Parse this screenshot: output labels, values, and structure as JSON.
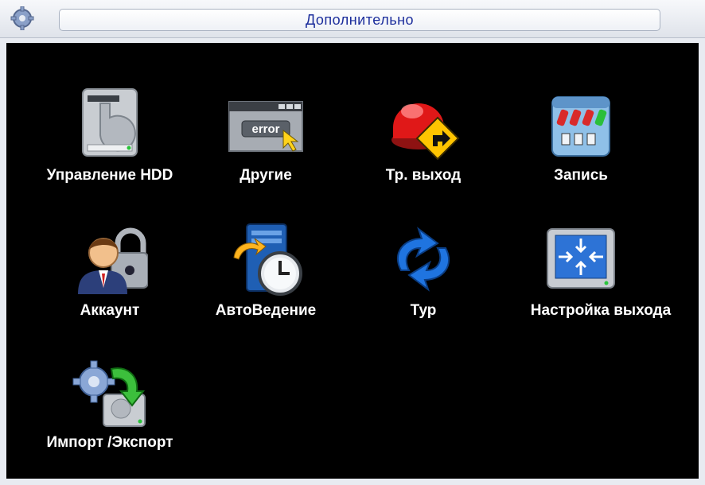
{
  "window": {
    "title": "Дополнительно"
  },
  "menu": {
    "items": [
      {
        "label": "Управление HDD",
        "icon": "hard-drive-icon"
      },
      {
        "label": "Другие",
        "icon": "error-window-icon"
      },
      {
        "label": "Тр. выход",
        "icon": "alarm-output-icon"
      },
      {
        "label": "Запись",
        "icon": "record-control-icon"
      },
      {
        "label": "Аккаунт",
        "icon": "account-lock-icon"
      },
      {
        "label": "АвтоВедение",
        "icon": "auto-maintain-clock-icon"
      },
      {
        "label": "Тур",
        "icon": "tour-rotate-icon"
      },
      {
        "label": "Настройка выхода",
        "icon": "output-adjust-monitor-icon"
      },
      {
        "label": "Импорт /Экспорт",
        "icon": "import-export-icon"
      }
    ]
  },
  "colors": {
    "title_text": "#1c2e9c",
    "background": "#000000",
    "label": "#ffffff"
  }
}
